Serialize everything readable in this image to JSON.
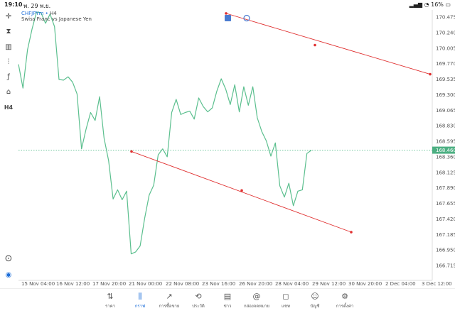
{
  "status": {
    "time": "19:10",
    "date": "พ. 29 พ.ย.",
    "battery": "16%"
  },
  "header": {
    "symbol": "CHFJPYm",
    "timeframe": "H4",
    "description": "Swiss Franc vs Japanese Yen"
  },
  "toolbar": {
    "items": [
      {
        "name": "crosshair-icon",
        "glyph": "✛"
      },
      {
        "name": "candles-icon",
        "glyph": "⧗"
      },
      {
        "name": "bars-icon",
        "glyph": "▥"
      },
      {
        "name": "indicators-icon",
        "glyph": "⫶"
      },
      {
        "name": "function-icon",
        "glyph": "ƒ"
      },
      {
        "name": "objects-icon",
        "glyph": "⌂"
      },
      {
        "name": "timeframe-label",
        "glyph": "H4"
      }
    ]
  },
  "chart_data": {
    "type": "line",
    "symbol": "CHFJPYm",
    "timeframe": "H4",
    "current_price": "168.460",
    "price_ticks": [
      "170.475",
      "170.240",
      "170.005",
      "169.770",
      "169.535",
      "169.300",
      "169.065",
      "168.830",
      "168.595",
      "168.360",
      "168.125",
      "167.890",
      "167.655",
      "167.420",
      "167.185",
      "166.950",
      "166.715"
    ],
    "time_labels": [
      "15 Nov 04:00",
      "16 Nov 12:00",
      "17 Nov 20:00",
      "21 Nov 00:00",
      "22 Nov 08:00",
      "23 Nov 16:00",
      "26 Nov 20:00",
      "28 Nov 04:00",
      "29 Nov 12:00",
      "30 Nov 20:00",
      "2 Dec 04:00",
      "3 Dec 12:00"
    ],
    "series": [
      {
        "values": [
          169.76,
          169.4,
          169.98,
          170.29,
          170.55,
          170.54,
          170.38,
          170.52,
          170.33,
          169.53,
          169.52,
          169.57,
          169.49,
          169.31,
          168.48,
          168.78,
          169.03,
          168.91,
          169.27,
          168.64,
          168.3,
          167.72,
          167.86,
          167.71,
          167.84,
          166.89,
          166.92,
          167.01,
          167.43,
          167.78,
          167.93,
          168.39,
          168.48,
          168.36,
          169.03,
          169.23,
          169.0,
          169.03,
          169.05,
          168.93,
          169.25,
          169.12,
          169.04,
          169.1,
          169.35,
          169.54,
          169.38,
          169.15,
          169.45,
          169.04,
          169.42,
          169.14,
          169.42,
          168.95,
          168.74,
          168.6,
          168.37,
          168.57,
          167.92,
          167.75,
          167.96,
          167.62,
          167.84,
          167.86,
          168.41,
          168.46
        ],
        "color": "#5bbf8e"
      }
    ],
    "trend_lines": [
      {
        "from": [
          "23 Nov 16:00",
          170.53
        ],
        "mid": [
          "29 Nov 12:00",
          170.05
        ],
        "to": [
          "3 Dec 12:00",
          169.61
        ],
        "color": "#e03030"
      },
      {
        "from": [
          "21 Nov 00:00",
          168.44
        ],
        "mid": [
          "26 Nov 20:00",
          167.85
        ],
        "to": [
          "30 Nov 20:00",
          167.22
        ],
        "color": "#e03030"
      }
    ]
  },
  "left_bottom_icons": [
    {
      "name": "timer-icon",
      "glyph": "⊙"
    },
    {
      "name": "app-logo-icon",
      "glyph": "◉"
    }
  ],
  "bottom_nav": [
    {
      "name": "nav-quotes",
      "icon": "⇅",
      "label": "ราคา"
    },
    {
      "name": "nav-chart",
      "icon": "⫼",
      "label": "กราฟ",
      "active": true
    },
    {
      "name": "nav-trade",
      "icon": "↗",
      "label": "การซื้อขาย"
    },
    {
      "name": "nav-history",
      "icon": "⟲",
      "label": "ประวัติ"
    },
    {
      "name": "nav-news",
      "icon": "▤",
      "label": "ข่าว"
    },
    {
      "name": "nav-mailbox",
      "icon": "@",
      "label": "กล่องจดหมาย"
    },
    {
      "name": "nav-chat",
      "icon": "◻",
      "label": "แชท"
    },
    {
      "name": "nav-account",
      "icon": "☺",
      "label": "บัญชี"
    },
    {
      "name": "nav-settings",
      "icon": "⚙",
      "label": "การตั้งค่า"
    }
  ]
}
